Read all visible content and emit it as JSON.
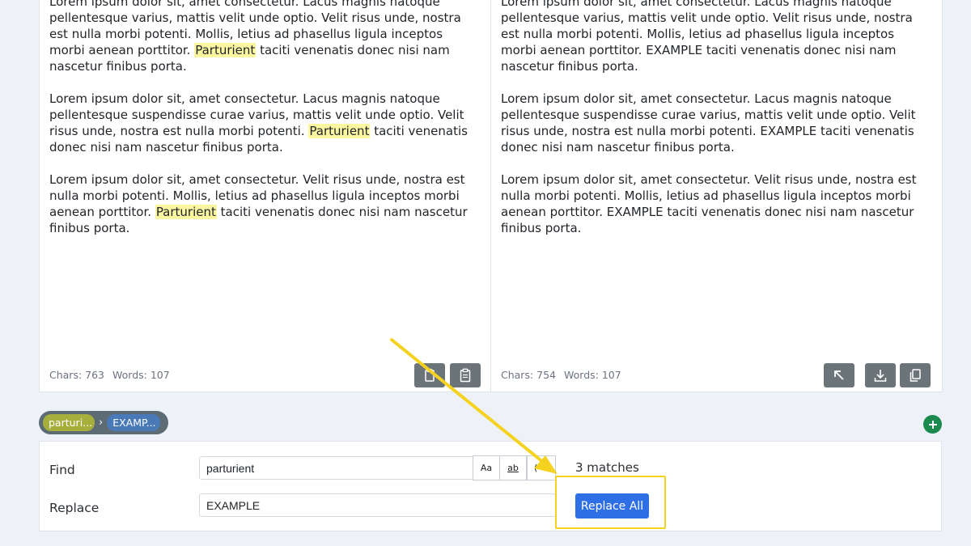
{
  "input": {
    "paragraphs": [
      [
        "Lorem ipsum dolor sit, amet consectetur. Lacus magnis natoque pellentesque varius, mattis velit unde optio. Velit risus unde, nostra est nulla morbi potenti. Mollis, letius ad phasellus ligula inceptos morbi aenean porttitor. ",
        "Parturient",
        " taciti venenatis donec nisi nam nascetur finibus porta."
      ],
      [
        "Lorem ipsum dolor sit, amet consectetur. Lacus magnis natoque pellentesque suspendisse curae varius, mattis velit unde optio. Velit risus unde, nostra est nulla morbi potenti. ",
        "Parturient",
        " taciti venenatis donec nisi nam nascetur finibus porta."
      ],
      [
        "Lorem ipsum dolor sit, amet consectetur. Velit risus unde, nostra est nulla morbi potenti. Mollis, letius ad phasellus ligula inceptos morbi aenean porttitor. ",
        "Parturient",
        " taciti venenatis donec nisi nam nascetur finibus porta."
      ]
    ],
    "chars_label": "Chars: 763",
    "words_label": "Words: 107"
  },
  "output": {
    "paragraphs": [
      "Lorem ipsum dolor sit, amet consectetur. Lacus magnis natoque pellentesque varius, mattis velit unde optio. Velit risus unde, nostra est nulla morbi potenti. Mollis, letius ad phasellus ligula inceptos morbi aenean porttitor. EXAMPLE taciti venenatis donec nisi nam nascetur finibus porta.",
      "Lorem ipsum dolor sit, amet consectetur. Lacus magnis natoque pellentesque suspendisse curae varius, mattis velit unde optio. Velit risus unde, nostra est nulla morbi potenti. EXAMPLE taciti venenatis donec nisi nam nascetur finibus porta.",
      "Lorem ipsum dolor sit, amet consectetur. Velit risus unde, nostra est nulla morbi potenti. Mollis, letius ad phasellus ligula inceptos morbi aenean porttitor. EXAMPLE taciti venenatis donec nisi nam nascetur finibus porta."
    ],
    "chars_label": "Chars: 754",
    "words_label": "Words: 107"
  },
  "chain": {
    "find_chip": "parturi...",
    "replace_chip": "EXAMP...",
    "separator": "›"
  },
  "find_replace": {
    "find_label": "Find",
    "replace_label": "Replace",
    "find_value": "parturient",
    "replace_value": "EXAMPLE",
    "match_case_label": "Aa",
    "whole_word_label": "ab",
    "regex_label": "(",
    "matches_text": "3 matches",
    "replace_all_label": "Replace All"
  },
  "colors": {
    "highlight": "#fbf7a0",
    "primary": "#2f6fe6",
    "annotation": "#f4d21f",
    "add": "#1a8a4e"
  },
  "icons": [
    "paste-icon",
    "clipboard-icon",
    "swap-up-icon",
    "download-icon",
    "copy-icon",
    "plus-icon",
    "chevron-right-icon"
  ]
}
